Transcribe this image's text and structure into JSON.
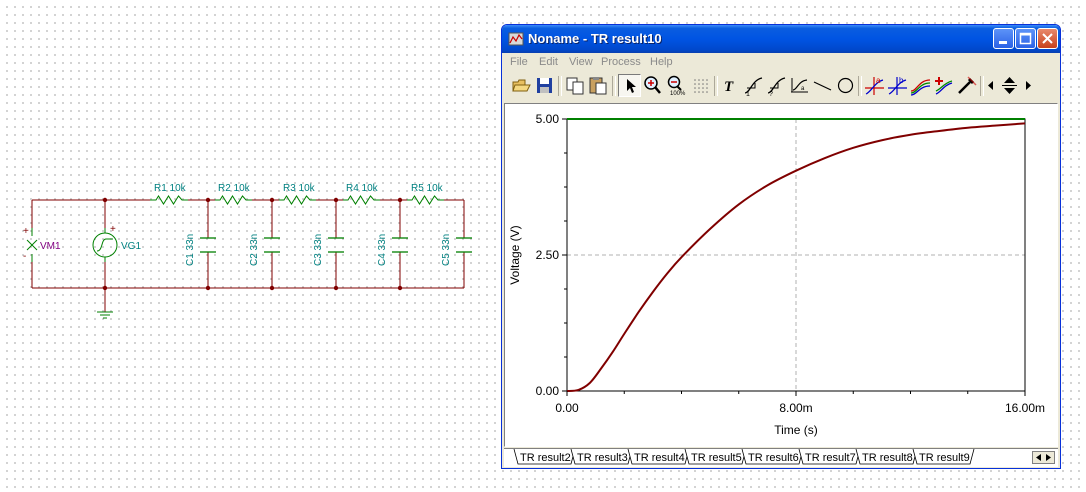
{
  "schematic": {
    "resistors": [
      {
        "label": "R1 10k"
      },
      {
        "label": "R2 10k"
      },
      {
        "label": "R3 10k"
      },
      {
        "label": "R4 10k"
      },
      {
        "label": "R5 10k"
      }
    ],
    "capacitors": [
      {
        "label": "C1 33n"
      },
      {
        "label": "C2 33n"
      },
      {
        "label": "C3 33n"
      },
      {
        "label": "C4 33n"
      },
      {
        "label": "C5 33n"
      }
    ],
    "meter": {
      "label": "VM1",
      "plus": "+",
      "minus": "-"
    },
    "generator": {
      "label": "VG1",
      "plus": "+"
    },
    "colors": {
      "wire": "#800000",
      "component": "#008000",
      "label": "#008080",
      "meter_label": "#800080"
    }
  },
  "window": {
    "title": "Noname - TR result10",
    "menu": [
      "File",
      "Edit",
      "View",
      "Process",
      "Help"
    ],
    "toolbar_icons": [
      "open-folder-icon",
      "save-icon",
      "copy-icon",
      "paste-icon",
      "pointer-icon",
      "zoom-in-icon",
      "zoom-100-icon",
      "grid-icon",
      "text-tool-icon",
      "curve-label-icon",
      "curve-label2-icon",
      "axis-label-icon",
      "line-tool-icon",
      "circle-tool-icon",
      "cursor-a-icon",
      "cursor-b-icon",
      "multi-curve-icon",
      "add-marker-icon",
      "eyedropper-icon",
      "nav-left-icon",
      "nav-updown-icon",
      "nav-right-icon"
    ],
    "tabs": [
      "TR result2",
      "TR result3",
      "TR result4",
      "TR result5",
      "TR result6",
      "TR result7",
      "TR result8",
      "TR result9"
    ]
  },
  "chart_data": {
    "type": "line",
    "xlabel": "Time (s)",
    "ylabel": "Voltage (V)",
    "xlim": [
      0,
      0.016
    ],
    "ylim": [
      0,
      5
    ],
    "x_ticks": [
      {
        "value": 0,
        "label": "0.00"
      },
      {
        "value": 0.008,
        "label": "8.00m"
      },
      {
        "value": 0.016,
        "label": "16.00m"
      }
    ],
    "y_ticks": [
      {
        "value": 0,
        "label": "0.00"
      },
      {
        "value": 2.5,
        "label": "2.50"
      },
      {
        "value": 5,
        "label": "5.00"
      }
    ],
    "grid": true,
    "series": [
      {
        "color": "#008000",
        "x": [
          0,
          0.016
        ],
        "y": [
          5,
          5
        ]
      },
      {
        "color": "#800000",
        "x": [
          0,
          0.0004,
          0.0008,
          0.0012,
          0.0016,
          0.002,
          0.0025,
          0.003,
          0.0035,
          0.004,
          0.005,
          0.006,
          0.007,
          0.008,
          0.009,
          0.01,
          0.011,
          0.012,
          0.013,
          0.014,
          0.015,
          0.016
        ],
        "y": [
          0,
          0.02,
          0.15,
          0.42,
          0.72,
          1.05,
          1.45,
          1.82,
          2.16,
          2.46,
          2.98,
          3.43,
          3.78,
          4.05,
          4.28,
          4.47,
          4.61,
          4.71,
          4.78,
          4.84,
          4.88,
          4.92
        ]
      }
    ]
  }
}
